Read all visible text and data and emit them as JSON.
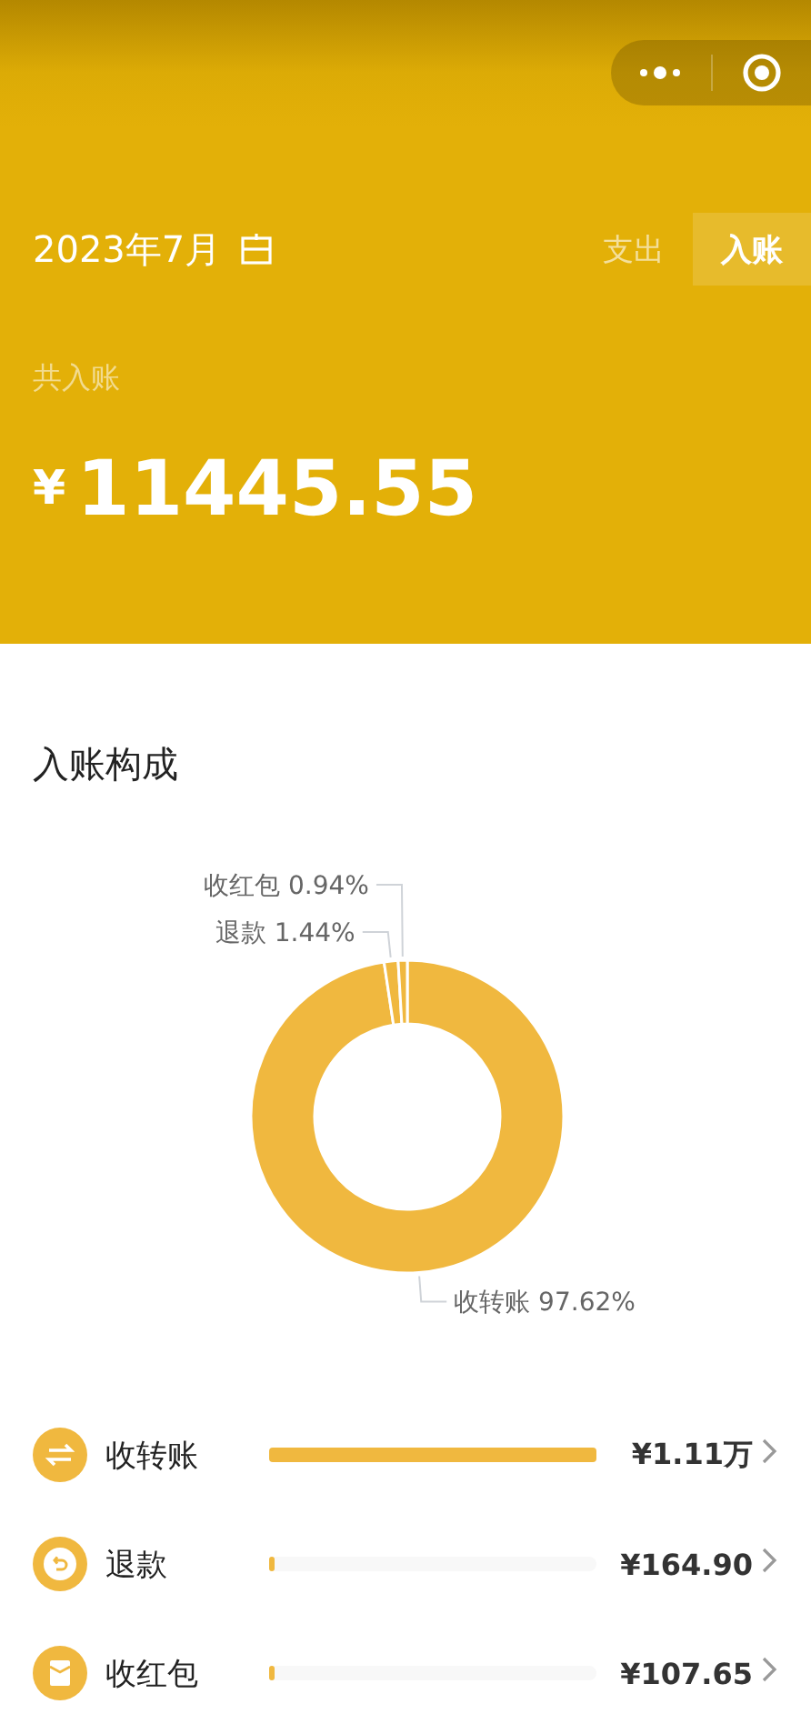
{
  "header": {
    "month": "2023年7月",
    "tabs": [
      {
        "label": "支出",
        "selected": false
      },
      {
        "label": "入账",
        "selected": true
      }
    ],
    "total_label": "共入账",
    "currency": "¥",
    "total": "11445.55"
  },
  "composition": {
    "title": "入账构成",
    "chart_data": {
      "type": "donut",
      "categories": [
        "收转账",
        "退款",
        "收红包"
      ],
      "series": [
        {
          "color": "#f0b83f",
          "values": [
            97.62,
            1.44,
            0.94
          ]
        }
      ],
      "value_labels": [
        "97.62%",
        "1.44%",
        "0.94%"
      ]
    }
  },
  "items": [
    {
      "kind": "transfer",
      "name": "收转账",
      "level": 1,
      "amount": "¥1.11万"
    },
    {
      "kind": "refund",
      "name": "退款",
      "level": 0.015,
      "amount": "¥164.90"
    },
    {
      "kind": "red_packet",
      "name": "收红包",
      "level": 0.015,
      "amount": "¥107.65"
    }
  ]
}
